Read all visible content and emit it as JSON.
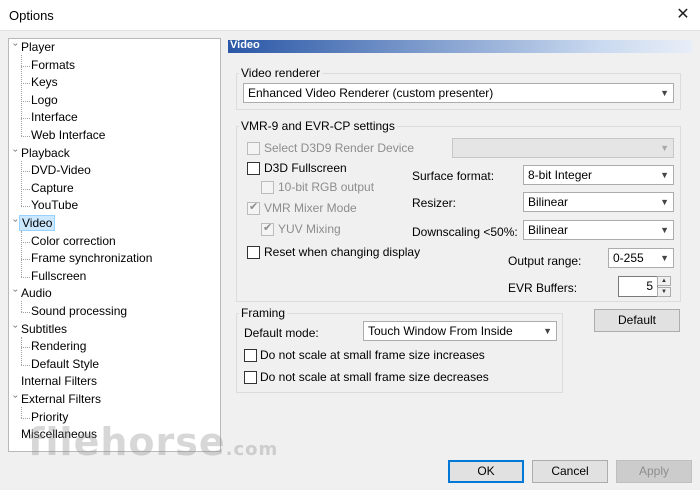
{
  "window": {
    "title": "Options",
    "close_icon": "close-icon"
  },
  "tree": {
    "items": [
      {
        "label": "Player",
        "level": 0,
        "expanded": true
      },
      {
        "label": "Formats",
        "level": 1
      },
      {
        "label": "Keys",
        "level": 1
      },
      {
        "label": "Logo",
        "level": 1
      },
      {
        "label": "Interface",
        "level": 1
      },
      {
        "label": "Web Interface",
        "level": 1
      },
      {
        "label": "Playback",
        "level": 0,
        "expanded": true
      },
      {
        "label": "DVD-Video",
        "level": 1
      },
      {
        "label": "Capture",
        "level": 1
      },
      {
        "label": "YouTube",
        "level": 1
      },
      {
        "label": "Video",
        "level": 0,
        "expanded": true,
        "selected": true
      },
      {
        "label": "Color correction",
        "level": 1
      },
      {
        "label": "Frame synchronization",
        "level": 1
      },
      {
        "label": "Fullscreen",
        "level": 1
      },
      {
        "label": "Audio",
        "level": 0,
        "expanded": true
      },
      {
        "label": "Sound processing",
        "level": 1
      },
      {
        "label": "Subtitles",
        "level": 0,
        "expanded": true
      },
      {
        "label": "Rendering",
        "level": 1
      },
      {
        "label": "Default Style",
        "level": 1
      },
      {
        "label": "Internal Filters",
        "level": 0
      },
      {
        "label": "External Filters",
        "level": 0,
        "expanded": true
      },
      {
        "label": "Priority",
        "level": 1
      },
      {
        "label": "Miscellaneous",
        "level": 0
      }
    ]
  },
  "page": {
    "header": "Video",
    "video_renderer": {
      "group_title": "Video renderer",
      "selected": "Enhanced Video Renderer (custom presenter)"
    },
    "vmr": {
      "group_title": "VMR-9 and EVR-CP settings",
      "select_d3d9": "Select D3D9 Render Device",
      "d3d_fullscreen": "D3D Fullscreen",
      "rgb_10bit": "10-bit RGB output",
      "vmr_mixer": "VMR Mixer Mode",
      "yuv_mixing": "YUV Mixing",
      "reset_display": "Reset when changing display",
      "surface_format_label": "Surface format:",
      "surface_format_value": "8-bit Integer",
      "resizer_label": "Resizer:",
      "resizer_value": "Bilinear",
      "downscaling_label": "Downscaling <50%:",
      "downscaling_value": "Bilinear",
      "output_range_label": "Output range:",
      "output_range_value": "0-255",
      "evr_buffers_label": "EVR Buffers:",
      "evr_buffers_value": "5"
    },
    "framing": {
      "group_title": "Framing",
      "default_mode_label": "Default mode:",
      "default_mode_value": "Touch Window From Inside",
      "no_scale_increase": "Do not scale at small frame size increases",
      "no_scale_decrease": "Do not scale at small frame size decreases"
    },
    "default_button": "Default"
  },
  "footer": {
    "ok": "OK",
    "cancel": "Cancel",
    "apply": "Apply"
  },
  "watermark": "filehorse.com"
}
